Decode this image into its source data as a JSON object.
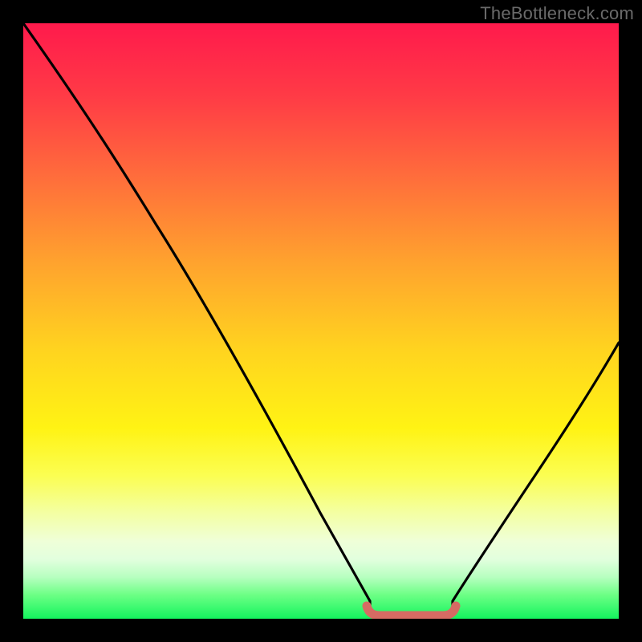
{
  "watermark": "TheBottleneck.com",
  "chart_data": {
    "type": "line",
    "title": "",
    "xlabel": "",
    "ylabel": "",
    "xlim": [
      0,
      100
    ],
    "ylim": [
      0,
      100
    ],
    "x": [
      0,
      5,
      10,
      15,
      20,
      25,
      30,
      35,
      40,
      45,
      50,
      55,
      57,
      60,
      65,
      70,
      72,
      75,
      80,
      85,
      90,
      95,
      100
    ],
    "values": [
      100,
      94,
      88,
      81,
      74,
      67,
      59,
      51,
      42,
      33,
      23,
      12,
      7,
      3,
      0.5,
      0.5,
      2,
      6,
      13,
      21,
      30,
      40,
      50
    ],
    "marker_segment": {
      "x_range": [
        58,
        72
      ],
      "y": 0.5,
      "color": "#d66b63"
    },
    "notes": "Solid black descending curve from top-left, reaches minimum near x≈64 with a short flat pink horizontal marker segment, then rises to mid-right. No visible axes, ticks, or legend."
  }
}
